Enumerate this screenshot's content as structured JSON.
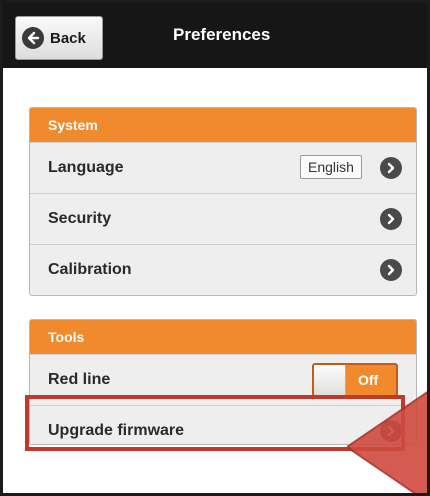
{
  "header": {
    "back_label": "Back",
    "title": "Preferences"
  },
  "system": {
    "heading": "System",
    "items": [
      {
        "label": "Language",
        "value": "English"
      },
      {
        "label": "Security"
      },
      {
        "label": "Calibration"
      }
    ]
  },
  "tools": {
    "heading": "Tools",
    "items": [
      {
        "label": "Red line",
        "toggle_state": "Off"
      },
      {
        "label": "Upgrade firmware"
      }
    ]
  },
  "colors": {
    "accent": "#f08a2c",
    "header_bg": "#161616",
    "highlight": "#c0392b"
  },
  "icons": [
    "back-arrow-icon",
    "chevron-right-icon",
    "highlight-arrow-icon"
  ]
}
